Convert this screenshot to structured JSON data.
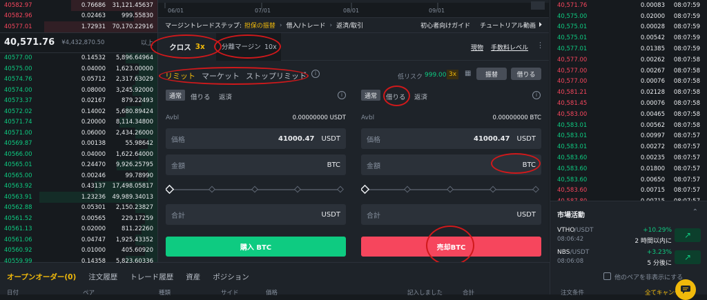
{
  "orderbook": {
    "asks": [
      {
        "price": "40582.97",
        "amount": "0.76686",
        "total": "31,121.45637"
      },
      {
        "price": "40582.96",
        "amount": "0.02463",
        "total": "999.55830"
      },
      {
        "price": "40577.01",
        "amount": "1.72931",
        "total": "70,170.22916"
      }
    ],
    "last_price": "40,571.76",
    "last_price_fiat": "¥4,432,870.50",
    "more_label": "以上",
    "bids": [
      {
        "price": "40577.00",
        "amount": "0.14532",
        "total": "5,896.64964"
      },
      {
        "price": "40575.00",
        "amount": "0.04000",
        "total": "1,623.00000"
      },
      {
        "price": "40574.76",
        "amount": "0.05712",
        "total": "2,317.63029"
      },
      {
        "price": "40574.00",
        "amount": "0.08000",
        "total": "3,245.92000"
      },
      {
        "price": "40573.37",
        "amount": "0.02167",
        "total": "879.22493"
      },
      {
        "price": "40572.02",
        "amount": "0.14002",
        "total": "5,680.89424"
      },
      {
        "price": "40571.74",
        "amount": "0.20000",
        "total": "8,114.34800"
      },
      {
        "price": "40571.00",
        "amount": "0.06000",
        "total": "2,434.26000"
      },
      {
        "price": "40569.87",
        "amount": "0.00138",
        "total": "55.98642"
      },
      {
        "price": "40566.00",
        "amount": "0.04000",
        "total": "1,622.64000"
      },
      {
        "price": "40565.01",
        "amount": "0.24470",
        "total": "9,926.25795"
      },
      {
        "price": "40565.00",
        "amount": "0.00246",
        "total": "99.78990"
      },
      {
        "price": "40563.92",
        "amount": "0.43137",
        "total": "17,498.05817"
      },
      {
        "price": "40563.91",
        "amount": "1.23236",
        "total": "49,989.34013"
      },
      {
        "price": "40562.88",
        "amount": "0.05301",
        "total": "2,150.23827"
      },
      {
        "price": "40561.52",
        "amount": "0.00565",
        "total": "229.17259"
      },
      {
        "price": "40561.13",
        "amount": "0.02000",
        "total": "811.22260"
      },
      {
        "price": "40561.06",
        "amount": "0.04747",
        "total": "1,925.43352"
      },
      {
        "price": "40560.92",
        "amount": "0.01000",
        "total": "405.60920"
      },
      {
        "price": "40559.99",
        "amount": "0.14358",
        "total": "5,823.60336"
      }
    ]
  },
  "chart": {
    "dates": [
      "06/01",
      "07/01",
      "08/01",
      "09/01"
    ]
  },
  "steps": {
    "label": "マージントレードステップ:",
    "step1": "担保の振替",
    "step2": "借入/トレード",
    "step3": "返済/取引",
    "guide": "初心者向けガイド",
    "tutorial": "チュートリアル動画"
  },
  "mode_tabs": {
    "cross": "クロス",
    "cross_lev": "3x",
    "isolated": "分離マージン",
    "isolated_lev": "10x",
    "spot": "現物",
    "fee": "手数料レベル"
  },
  "order_types": {
    "limit": "リミット",
    "market": "マーケット",
    "stop_limit": "ストップリミット",
    "risk_label": "低リスク",
    "risk_value": "999.00",
    "leverage": "3x",
    "transfer": "振替",
    "borrow": "借りる"
  },
  "buy": {
    "tabs": [
      "通常",
      "借りる",
      "返済"
    ],
    "avbl_label": "Avbl",
    "avbl_value": "0.00000000 USDT",
    "price_label": "価格",
    "price_value": "41000.47",
    "price_unit": "USDT",
    "amount_label": "金額",
    "amount_unit": "BTC",
    "total_label": "合計",
    "total_unit": "USDT",
    "button": "購入 BTC"
  },
  "sell": {
    "tabs": [
      "通常",
      "借りる",
      "返済"
    ],
    "avbl_label": "Avbl",
    "avbl_value": "0.00000000 BTC",
    "price_label": "価格",
    "price_value": "41000.47",
    "price_unit": "USDT",
    "amount_label": "金額",
    "amount_unit": "BTC",
    "total_label": "合計",
    "total_unit": "USDT",
    "button": "売却BTC"
  },
  "trades": [
    {
      "price": "40,571.76",
      "amount": "0.00083",
      "time": "08:07:59",
      "side": "dn"
    },
    {
      "price": "40,575.00",
      "amount": "0.02000",
      "time": "08:07:59",
      "side": "up"
    },
    {
      "price": "40,575.01",
      "amount": "0.00028",
      "time": "08:07:59",
      "side": "up"
    },
    {
      "price": "40,575.01",
      "amount": "0.00542",
      "time": "08:07:59",
      "side": "up"
    },
    {
      "price": "40,577.01",
      "amount": "0.01385",
      "time": "08:07:59",
      "side": "up"
    },
    {
      "price": "40,577.00",
      "amount": "0.00262",
      "time": "08:07:58",
      "side": "dn"
    },
    {
      "price": "40,577.00",
      "amount": "0.00267",
      "time": "08:07:58",
      "side": "dn"
    },
    {
      "price": "40,577.00",
      "amount": "0.00076",
      "time": "08:07:58",
      "side": "dn"
    },
    {
      "price": "40,581.21",
      "amount": "0.02128",
      "time": "08:07:58",
      "side": "dn"
    },
    {
      "price": "40,581.45",
      "amount": "0.00076",
      "time": "08:07:58",
      "side": "dn"
    },
    {
      "price": "40,583.00",
      "amount": "0.00465",
      "time": "08:07:58",
      "side": "dn"
    },
    {
      "price": "40,583.01",
      "amount": "0.00562",
      "time": "08:07:58",
      "side": "up"
    },
    {
      "price": "40,583.01",
      "amount": "0.00997",
      "time": "08:07:57",
      "side": "up"
    },
    {
      "price": "40,583.01",
      "amount": "0.00272",
      "time": "08:07:57",
      "side": "up"
    },
    {
      "price": "40,583.60",
      "amount": "0.00235",
      "time": "08:07:57",
      "side": "up"
    },
    {
      "price": "40,583.60",
      "amount": "0.01800",
      "time": "08:07:57",
      "side": "up"
    },
    {
      "price": "40,583.60",
      "amount": "0.00650",
      "time": "08:07:57",
      "side": "up"
    },
    {
      "price": "40,583.60",
      "amount": "0.00715",
      "time": "08:07:57",
      "side": "dn"
    },
    {
      "price": "40,587.80",
      "amount": "0.00715",
      "time": "08:07:57",
      "side": "dn"
    },
    {
      "price": "40,587.80",
      "amount": "0.00308",
      "time": "08:07:57",
      "side": "dn"
    }
  ],
  "market_activity": {
    "title": "市場活動",
    "items": [
      {
        "pair": "VTHO",
        "quote": "/USDT",
        "time": "08:06:42",
        "change": "+10.29%",
        "note": "2 時間以内に"
      },
      {
        "pair": "NBS",
        "quote": "/USDT",
        "time": "08:06:08",
        "change": "+3.23%",
        "note": "5 分後に"
      }
    ]
  },
  "bottom": {
    "tabs": [
      "オープンオーダー(0)",
      "注文履歴",
      "トレード履歴",
      "資産",
      "ポジション"
    ],
    "hide_pairs": "他のペアを非表示にする",
    "columns": [
      "日付",
      "ペア",
      "種類",
      "サイド",
      "価格",
      "記入しました",
      "合計",
      "注文条件"
    ],
    "cancel_all": "全てキャンセル"
  }
}
